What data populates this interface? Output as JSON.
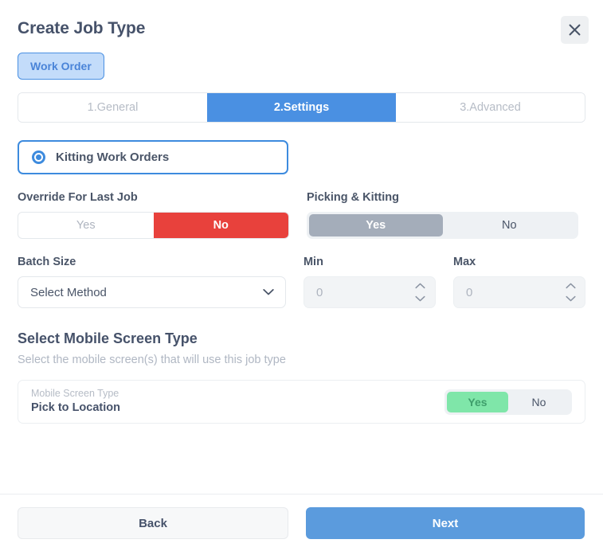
{
  "header": {
    "title": "Create Job Type",
    "close_icon": "close-icon"
  },
  "type_badge": {
    "label": "Work Order"
  },
  "steps": [
    {
      "label": "1.General",
      "active": false
    },
    {
      "label": "2.Settings",
      "active": true
    },
    {
      "label": "3.Advanced",
      "active": false
    }
  ],
  "kitting": {
    "label": "Kitting Work Orders",
    "selected": true
  },
  "override_for_last_job": {
    "label": "Override For Last Job",
    "yes_label": "Yes",
    "no_label": "No",
    "selected": "No"
  },
  "picking_and_kitting": {
    "label": "Picking & Kitting",
    "yes_label": "Yes",
    "no_label": "No",
    "selected": "Yes"
  },
  "batch_size": {
    "label": "Batch Size",
    "selected_option": "Select Method",
    "chevron_icon": "chevron-down-icon"
  },
  "min_field": {
    "label": "Min",
    "value": "0",
    "up_icon": "chevron-up-icon",
    "down_icon": "chevron-down-icon"
  },
  "max_field": {
    "label": "Max",
    "value": "0",
    "up_icon": "chevron-up-icon",
    "down_icon": "chevron-down-icon"
  },
  "mobile_section": {
    "title": "Select Mobile Screen Type",
    "subtitle": "Select the mobile screen(s) that will use this job type",
    "row": {
      "caption": "Mobile Screen Type",
      "name": "Pick to Location",
      "yes_label": "Yes",
      "no_label": "No",
      "selected": "Yes"
    }
  },
  "footer": {
    "back_label": "Back",
    "next_label": "Next"
  },
  "colors": {
    "accent_blue": "#4a90e2",
    "badge_bg": "#c3dcfa",
    "danger_red": "#e8413c",
    "muted_grey": "#a4adba",
    "success_green": "#7fe6a9",
    "next_blue": "#5b9bdd"
  }
}
